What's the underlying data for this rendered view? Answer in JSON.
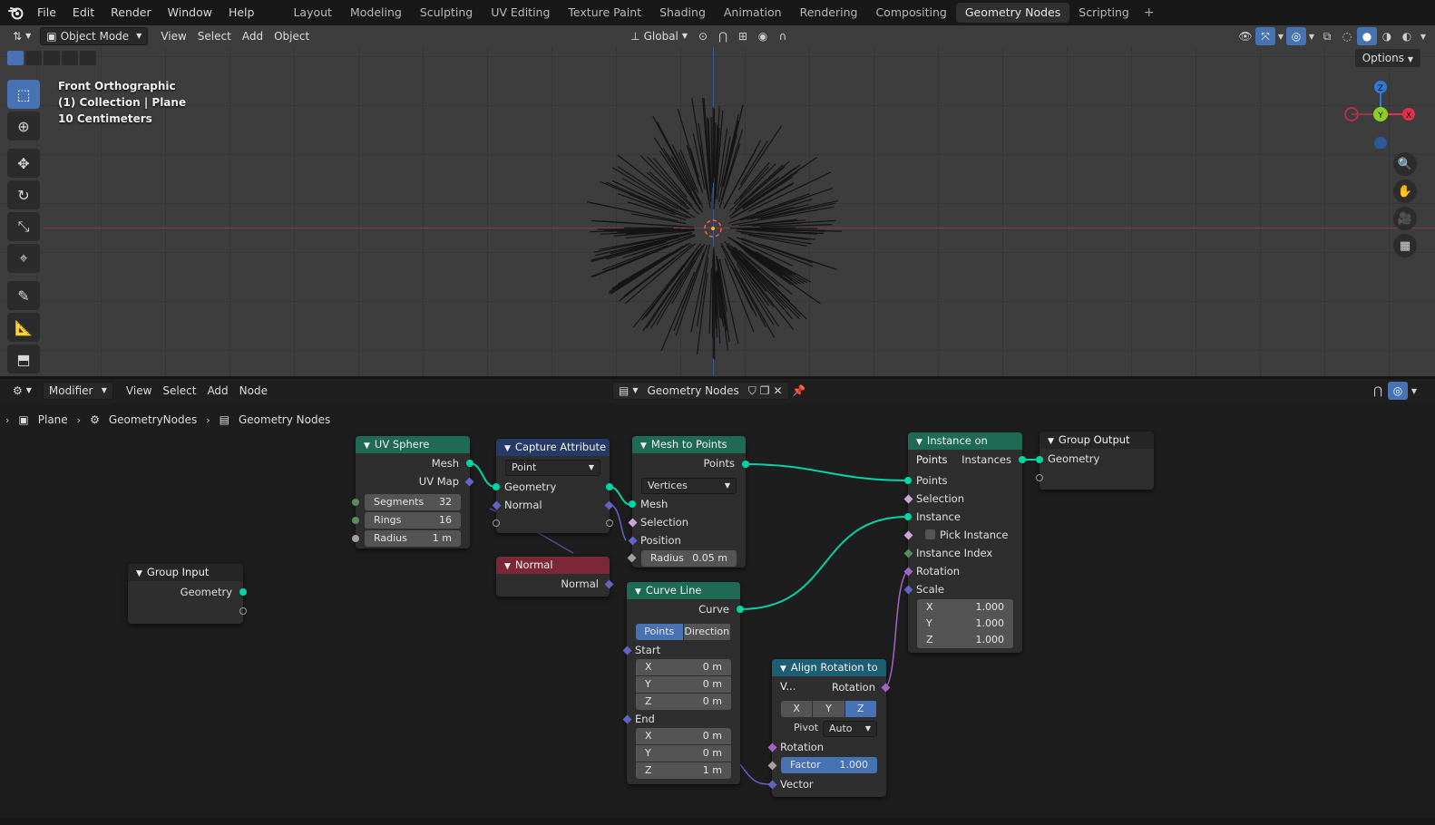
{
  "topbar": {
    "menus": [
      "File",
      "Edit",
      "Render",
      "Window",
      "Help"
    ],
    "workspaces": [
      "Layout",
      "Modeling",
      "Sculpting",
      "UV Editing",
      "Texture Paint",
      "Shading",
      "Animation",
      "Rendering",
      "Compositing",
      "Geometry Nodes",
      "Scripting"
    ],
    "active_workspace": "Geometry Nodes",
    "add_tab": "+"
  },
  "viewport": {
    "mode": "Object Mode",
    "menus": [
      "View",
      "Select",
      "Add",
      "Object"
    ],
    "transform_orientation": "Global",
    "options_label": "Options",
    "info": {
      "view_name": "Front Orthographic",
      "collection": "(1) Collection | Plane",
      "scale": "10 Centimeters"
    },
    "gizmo": {
      "z": "Z",
      "y": "Y",
      "x": "X"
    },
    "colors": {
      "x_axis": "#e2304a",
      "y_axis": "#8ccd26",
      "z_axis": "#2f7ad6",
      "active": "#4772b3"
    }
  },
  "node_editor": {
    "header": {
      "editor_type": "Modifier",
      "menus": [
        "View",
        "Select",
        "Add",
        "Node"
      ],
      "node_tree": "Geometry Nodes"
    },
    "breadcrumb": [
      "Plane",
      "GeometryNodes",
      "Geometry Nodes"
    ],
    "nodes": {
      "uv_sphere": {
        "title": "UV Sphere",
        "outputs": [
          "Mesh",
          "UV Map"
        ],
        "segments_label": "Segments",
        "segments_value": "32",
        "rings_label": "Rings",
        "rings_value": "16",
        "radius_label": "Radius",
        "radius_value": "1 m"
      },
      "capture_attribute": {
        "title": "Capture Attribute",
        "domain": "Point",
        "rows": [
          "Geometry",
          "Normal"
        ]
      },
      "normal": {
        "title": "Normal",
        "output": "Normal"
      },
      "mesh_to_points": {
        "title": "Mesh to Points",
        "output": "Points",
        "mode": "Vertices",
        "inputs": [
          "Mesh",
          "Selection",
          "Position"
        ],
        "radius_label": "Radius",
        "radius_value": "0.05 m"
      },
      "curve_line": {
        "title": "Curve Line",
        "output": "Curve",
        "mode_points": "Points",
        "mode_direction": "Direction",
        "start_label": "Start",
        "start": [
          {
            "axis": "X",
            "value": "0 m"
          },
          {
            "axis": "Y",
            "value": "0 m"
          },
          {
            "axis": "Z",
            "value": "0 m"
          }
        ],
        "end_label": "End",
        "end": [
          {
            "axis": "X",
            "value": "0 m"
          },
          {
            "axis": "Y",
            "value": "0 m"
          },
          {
            "axis": "Z",
            "value": "1 m"
          }
        ]
      },
      "align_rotation": {
        "title": "Align Rotation to V...",
        "output": "Rotation",
        "axis_x": "X",
        "axis_y": "Y",
        "axis_z": "Z",
        "pivot_label": "Pivot",
        "pivot_value": "Auto",
        "rotation_label": "Rotation",
        "factor_label": "Factor",
        "factor_value": "1.000",
        "vector_label": "Vector"
      },
      "instance_on_points": {
        "title": "Instance on Points",
        "output": "Instances",
        "inputs": [
          "Points",
          "Selection",
          "Instance",
          "Pick Instance",
          "Instance Index",
          "Rotation",
          "Scale"
        ],
        "scale": [
          {
            "axis": "X",
            "value": "1.000"
          },
          {
            "axis": "Y",
            "value": "1.000"
          },
          {
            "axis": "Z",
            "value": "1.000"
          }
        ]
      },
      "group_input": {
        "title": "Group Input",
        "output": "Geometry"
      },
      "group_output": {
        "title": "Group Output",
        "input": "Geometry"
      }
    },
    "colors": {
      "geometry_socket": "#00d6a3",
      "vector_socket": "#6363c7",
      "rotation_socket": "#a663c7"
    }
  }
}
